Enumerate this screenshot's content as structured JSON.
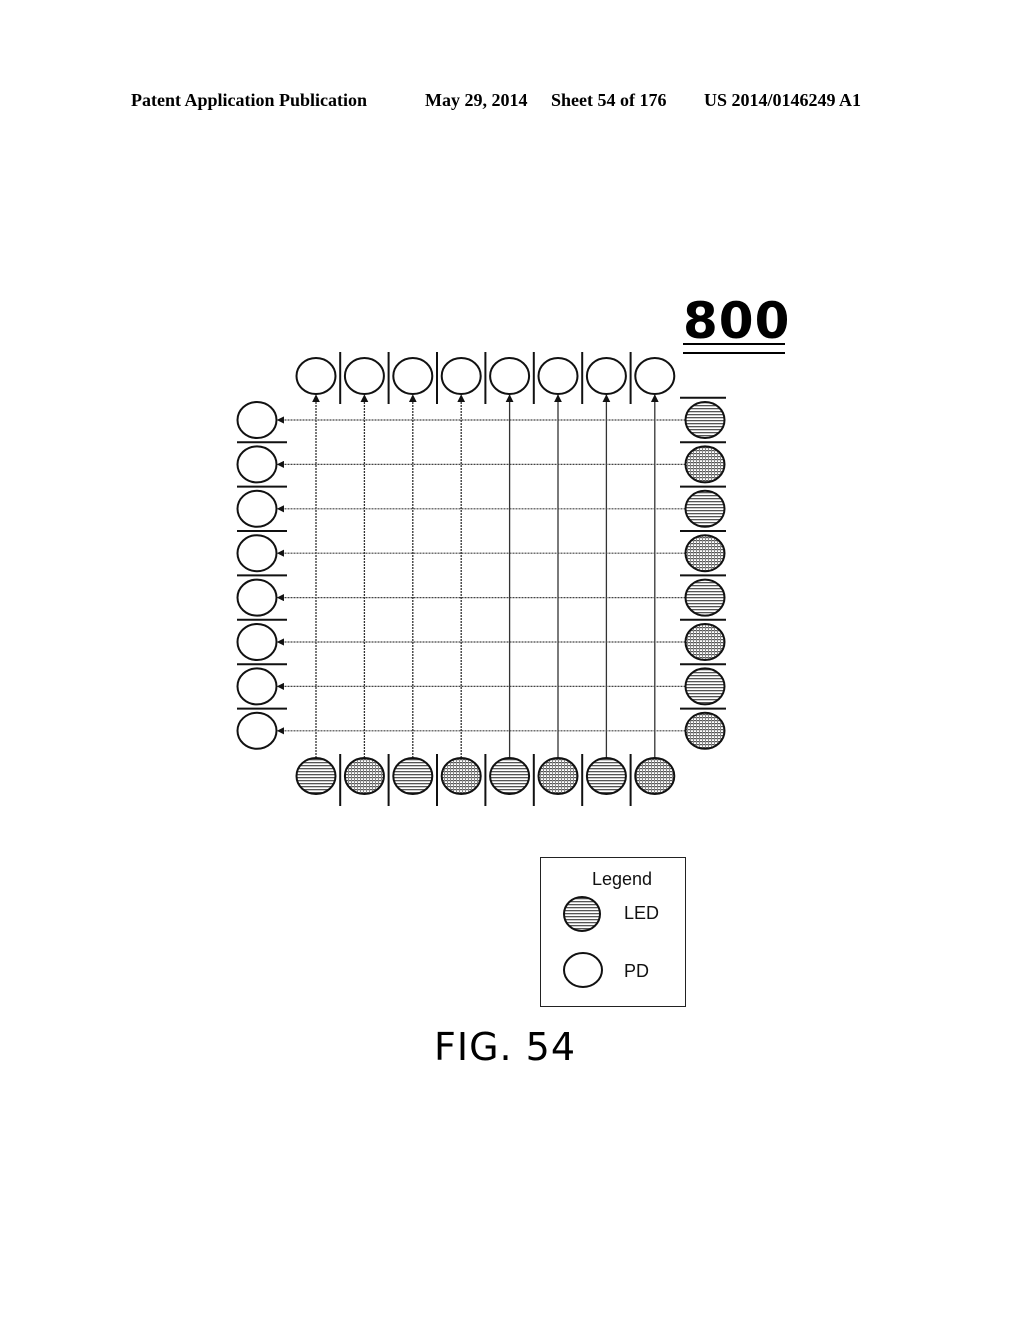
{
  "header": {
    "publication": "Patent Application Publication",
    "date": "May 29, 2014",
    "sheet": "Sheet 54 of 176",
    "patent_number": "US 2014/0146249 A1"
  },
  "figure": {
    "reference_numeral": "800",
    "caption": "FIG. 54"
  },
  "grid": {
    "columns": 8,
    "rows": 8,
    "top_row": {
      "component": "PD",
      "count": 8
    },
    "bottom_row": {
      "component": "LED",
      "count": 8
    },
    "left_column": {
      "component": "PD",
      "count": 8
    },
    "right_column": {
      "component": "LED",
      "count": 8
    },
    "vertical_beams": {
      "direction": "bottom-to-top",
      "from": "LED",
      "to": "PD"
    },
    "horizontal_beams": {
      "direction": "right-to-left",
      "from": "LED",
      "to": "PD"
    }
  },
  "legend": {
    "title": "Legend",
    "items": [
      {
        "label": "LED",
        "icon": "hatched-circle-icon"
      },
      {
        "label": "PD",
        "icon": "empty-circle-icon"
      }
    ]
  },
  "colors": {
    "ink": "#111111",
    "hatch": "#555555",
    "background": "#ffffff"
  }
}
